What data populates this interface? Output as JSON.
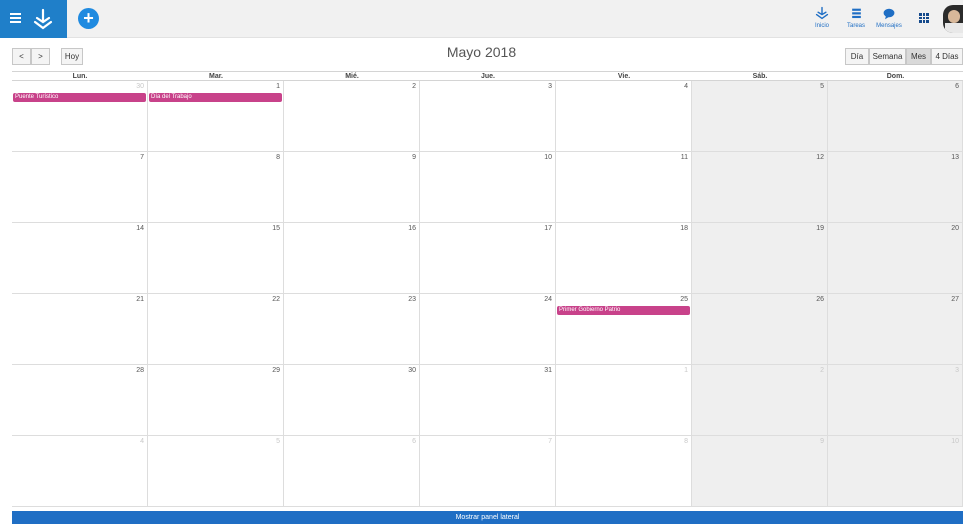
{
  "topbar": {
    "nav": [
      {
        "label": "Inicio",
        "icon": "home-icon"
      },
      {
        "label": "Tareas",
        "icon": "tasks-icon"
      },
      {
        "label": "Mensajes",
        "icon": "messages-icon"
      }
    ]
  },
  "toolbar": {
    "prev": "<",
    "next": ">",
    "today": "Hoy",
    "title": "Mayo 2018",
    "views": [
      "Día",
      "Semana",
      "Mes",
      "4 Días"
    ],
    "active_view": "Mes"
  },
  "calendar": {
    "headers": [
      "Lun.",
      "Mar.",
      "Mié.",
      "Jue.",
      "Vie.",
      "Sáb.",
      "Dom."
    ],
    "weeks": [
      [
        {
          "n": "30",
          "o": true
        },
        {
          "n": "1"
        },
        {
          "n": "2"
        },
        {
          "n": "3"
        },
        {
          "n": "4"
        },
        {
          "n": "5"
        },
        {
          "n": "6"
        }
      ],
      [
        {
          "n": "7"
        },
        {
          "n": "8"
        },
        {
          "n": "9"
        },
        {
          "n": "10"
        },
        {
          "n": "11"
        },
        {
          "n": "12"
        },
        {
          "n": "13"
        }
      ],
      [
        {
          "n": "14"
        },
        {
          "n": "15"
        },
        {
          "n": "16"
        },
        {
          "n": "17"
        },
        {
          "n": "18"
        },
        {
          "n": "19"
        },
        {
          "n": "20"
        }
      ],
      [
        {
          "n": "21"
        },
        {
          "n": "22"
        },
        {
          "n": "23"
        },
        {
          "n": "24"
        },
        {
          "n": "25"
        },
        {
          "n": "26"
        },
        {
          "n": "27"
        }
      ],
      [
        {
          "n": "28"
        },
        {
          "n": "29"
        },
        {
          "n": "30"
        },
        {
          "n": "31"
        },
        {
          "n": "1",
          "o": true
        },
        {
          "n": "2",
          "o": true
        },
        {
          "n": "3",
          "o": true
        }
      ],
      [
        {
          "n": "4",
          "o": true
        },
        {
          "n": "5",
          "o": true
        },
        {
          "n": "6",
          "o": true
        },
        {
          "n": "7",
          "o": true
        },
        {
          "n": "8",
          "o": true
        },
        {
          "n": "9",
          "o": true
        },
        {
          "n": "10",
          "o": true
        }
      ]
    ],
    "events": [
      {
        "title": "Puente Turístico",
        "week": 0,
        "day": 0
      },
      {
        "title": "Día del Trabajo",
        "week": 0,
        "day": 1
      },
      {
        "title": "Primer Gobierno Patrio",
        "week": 3,
        "day": 4
      }
    ]
  },
  "footer": {
    "label": "Mostrar panel lateral"
  },
  "colors": {
    "brand": "#1f7fc9",
    "event": "#c8428a",
    "weekend": "#efefef",
    "footer": "#1f6ec4"
  }
}
